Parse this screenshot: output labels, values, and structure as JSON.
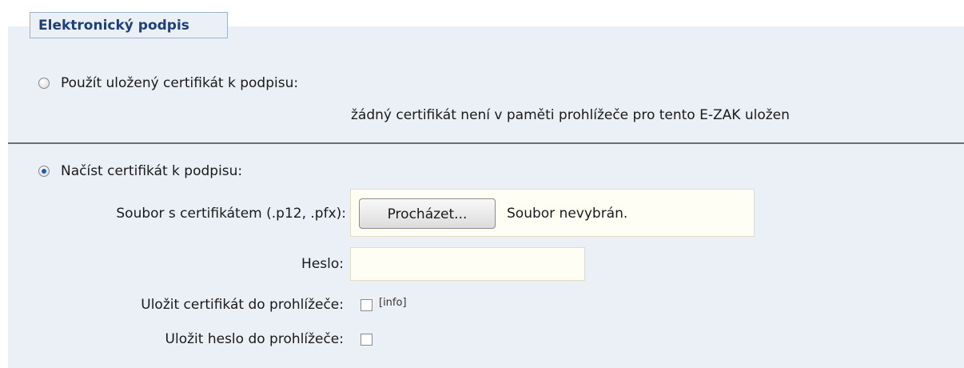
{
  "fieldset": {
    "legend": "Elektronický podpis"
  },
  "stored_option": {
    "label": "Použít uložený certifikát k podpisu:",
    "selected": false,
    "status": "žádný certifikát není v paměti prohlížeče pro tento E-ZAK uložen"
  },
  "load_option": {
    "label": "Načíst certifikát k podpisu:",
    "selected": true
  },
  "file_field": {
    "label": "Soubor s certifikátem (.p12, .pfx):",
    "button_label": "Procházet...",
    "status": "Soubor nevybrán."
  },
  "password_field": {
    "label": "Heslo:",
    "value": ""
  },
  "save_certificate": {
    "label": "Uložit certifikát do prohlížeče:",
    "checked": false,
    "info_link": "[info]"
  },
  "save_password": {
    "label": "Uložit heslo do prohlížeče:",
    "checked": false
  },
  "colors": {
    "panel_bg": "#eaf0f6",
    "legend_text": "#1f3f77",
    "input_bg": "#fffef5"
  }
}
